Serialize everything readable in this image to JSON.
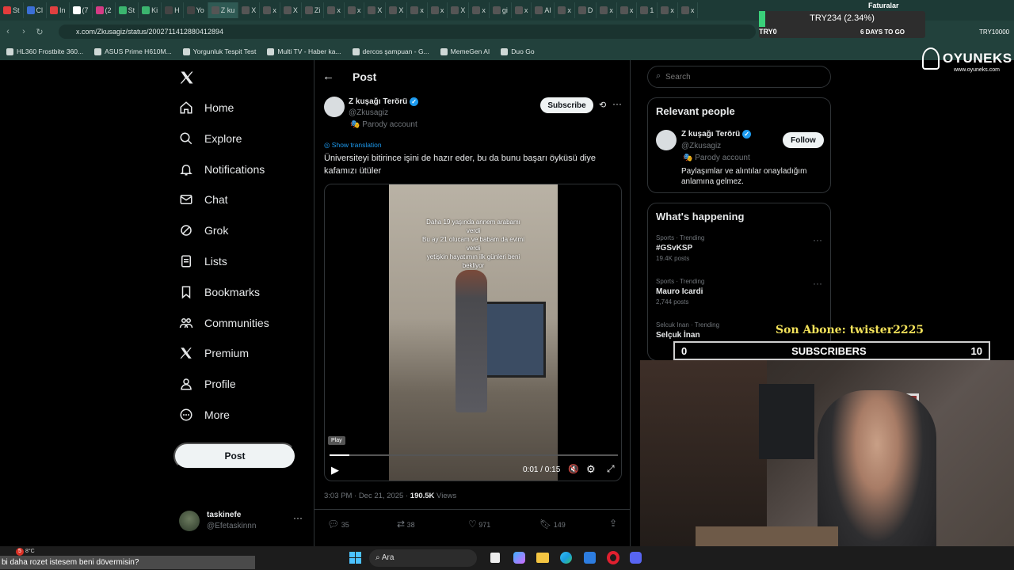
{
  "browser": {
    "tabs": [
      "St",
      "Cl",
      "In",
      "(7",
      "(2",
      "St",
      "Ki",
      "H",
      "Yo",
      "Z ku",
      "X",
      "x",
      "X",
      "Zi",
      "x",
      "x",
      "X",
      "X",
      "x",
      "x",
      "X",
      "x",
      "gi",
      "x",
      "Al",
      "x",
      "D",
      "x",
      "x",
      "1",
      "x",
      "x"
    ],
    "url": "x.com/Zkusagiz/status/2002711412880412894",
    "bookmarks": [
      "HL360 Frostbite 360...",
      "ASUS Prime H610M...",
      "Yorgunluk Tespit Test",
      "Multi TV - Haber ka...",
      "dercos şampuan - G...",
      "MemeGen AI",
      "Duo Go"
    ],
    "ticker": {
      "pair": "TRY234 (2.34%)",
      "label": "TRY0",
      "countdown": "6 DAYS TO GO",
      "balance": "TRY10000",
      "top_text": "Faturalar"
    }
  },
  "sidebar": {
    "items": [
      {
        "label": "Home",
        "icon": "home-icon"
      },
      {
        "label": "Explore",
        "icon": "search-icon"
      },
      {
        "label": "Notifications",
        "icon": "bell-icon"
      },
      {
        "label": "Chat",
        "icon": "mail-icon"
      },
      {
        "label": "Grok",
        "icon": "grok-icon"
      },
      {
        "label": "Lists",
        "icon": "list-icon"
      },
      {
        "label": "Bookmarks",
        "icon": "bookmark-icon"
      },
      {
        "label": "Communities",
        "icon": "people-icon"
      },
      {
        "label": "Premium",
        "icon": "x-logo-icon"
      },
      {
        "label": "Profile",
        "icon": "person-icon"
      },
      {
        "label": "More",
        "icon": "more-circle-icon"
      }
    ],
    "post_button": "Post",
    "account": {
      "name": "taskinefe",
      "handle": "@Efetaskinnn"
    }
  },
  "post": {
    "header_title": "Post",
    "author_name": "Z kuşağı Terörü",
    "author_handle": "@Zkusagiz",
    "parody_label": "Parody account",
    "subscribe_label": "Subscribe",
    "show_translation": "Show translation",
    "text": "Üniversiteyi bitirince işini de hazır eder, bu da bunu başarı öyküsü diye kafamızı ütüler",
    "video_caption": "Daha 19 yaşında annem arabamı verdi\nBu ay 21 olucam ve babam da evimi verdi\nyetişkin hayatımın ilk günleri beni bekliyor",
    "video_tooltip": "Play",
    "video_time": "0:01 / 0:15",
    "video_progress": 0.07,
    "timestamp": "3:03 PM · Dec 21, 2025 · ",
    "views_count": "190.5K",
    "views_label": " Views",
    "stats": {
      "replies": "35",
      "reposts": "38",
      "likes": "971",
      "bookmarks": "149"
    }
  },
  "right": {
    "search_placeholder": "Search",
    "relevant_title": "Relevant people",
    "relevant": {
      "name": "Z kuşağı Terörü",
      "handle": "@Zkusagiz",
      "parody_label": "Parody account",
      "follow_label": "Follow",
      "bio": "Paylaşımlar ve alıntılar onayladığım anlamına gelmez."
    },
    "happening_title": "What's happening",
    "trends": [
      {
        "context": "Sports · Trending",
        "title": "#GSvKSP",
        "posts": "19.4K posts"
      },
      {
        "context": "Sports · Trending",
        "title": "Mauro Icardi",
        "posts": "2,744 posts"
      },
      {
        "context": "Selcuk Inan · Trending",
        "title": "Selçuk İnan",
        "posts": ""
      }
    ]
  },
  "stream": {
    "logo_text": "OYUNEKS",
    "logo_sub": "www.oyuneks.com",
    "last_sub_label": "Son Abone: twister2225",
    "subs_current": "0",
    "subs_label": "SUBSCRIBERS",
    "subs_goal": "10",
    "chat_message": "bi daha rozet istesem beni dövermisin?"
  },
  "taskbar": {
    "search_label": "Ara",
    "weather": "8°C",
    "notif_count": "5"
  }
}
